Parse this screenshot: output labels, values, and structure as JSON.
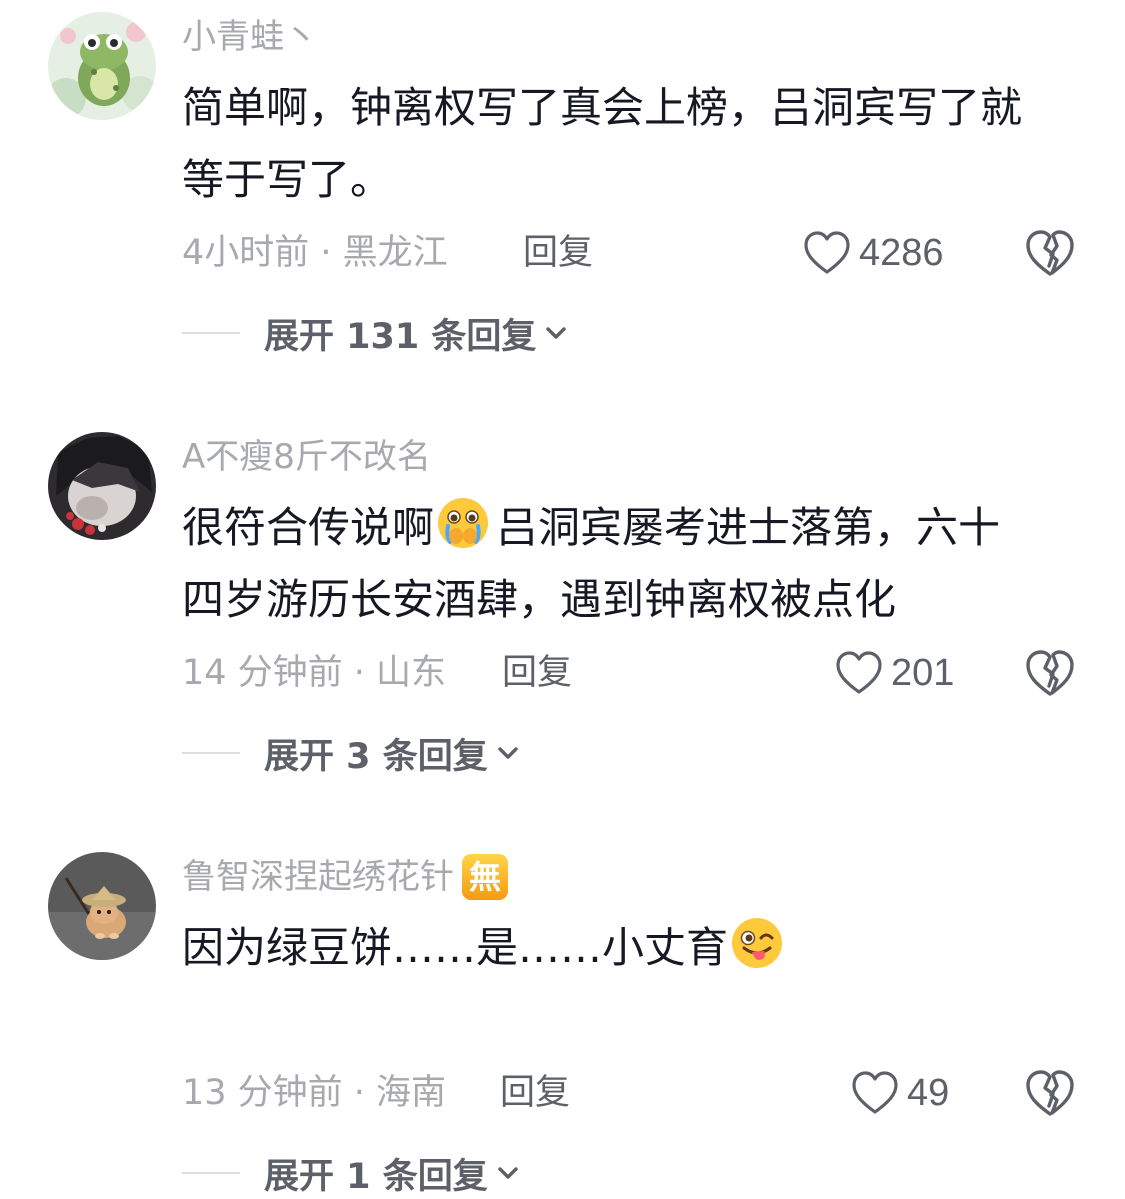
{
  "comments": [
    {
      "username": "小青蛙丶",
      "badge": "",
      "text_line1": "简单啊，钟离权写了真会上榜，吕洞宾写了就",
      "text_line2": "等于写了。",
      "text_emoji": "",
      "meta": "4小时前 · 黑龙江",
      "reply_label": "回复",
      "like_count": "4286",
      "expand_label": "展开 131 条回复",
      "avatar_icon": "frog-avatar"
    },
    {
      "username": "A不瘦8斤不改名",
      "badge": "",
      "text_part1": "很符合传说啊",
      "text_emoji": "crying-face-emoji",
      "text_part2": "吕洞宾屡考进士落第，六十",
      "text_line2": "四岁游历长安酒肆，遇到钟离权被点化",
      "meta": "14 分钟前 · 山东",
      "reply_label": "回复",
      "like_count": "201",
      "expand_label": "展开 3 条回复",
      "avatar_icon": "anime-avatar"
    },
    {
      "username": "鲁智深捏起绣花针",
      "badge": "無",
      "text_part1": "因为绿豆饼……是……小丈育",
      "text_emoji": "winking-tongue-emoji",
      "meta": "13 分钟前 · 海南",
      "reply_label": "回复",
      "like_count": "49",
      "expand_label": "展开 1 条回复",
      "avatar_icon": "hamster-avatar"
    }
  ],
  "icons": {
    "like": "heart-outline-icon",
    "dislike": "broken-heart-icon",
    "expand": "chevron-down-icon"
  },
  "colors": {
    "text": "#161823",
    "secondary": "#a7a9ae",
    "action": "#5d6068",
    "badge": "#f5a623"
  }
}
